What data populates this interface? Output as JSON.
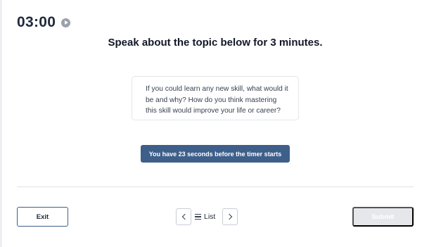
{
  "timer": {
    "display": "03:00",
    "play_icon": "play-circle-icon"
  },
  "heading": "Speak about the topic below for 3 minutes.",
  "prompt": {
    "text": "If you could learn any new skill, what would it be and why? How do you think mastering this skill would improve your life or career?"
  },
  "countdown": {
    "label": "You have 23 seconds before the timer starts",
    "color": "#3e5f8a"
  },
  "footer": {
    "exit_label": "Exit",
    "prev_icon": "chevron-left-icon",
    "next_icon": "chevron-right-icon",
    "list_icon": "hamburger-list-icon",
    "list_label": "List",
    "submit_label": "Submit"
  }
}
